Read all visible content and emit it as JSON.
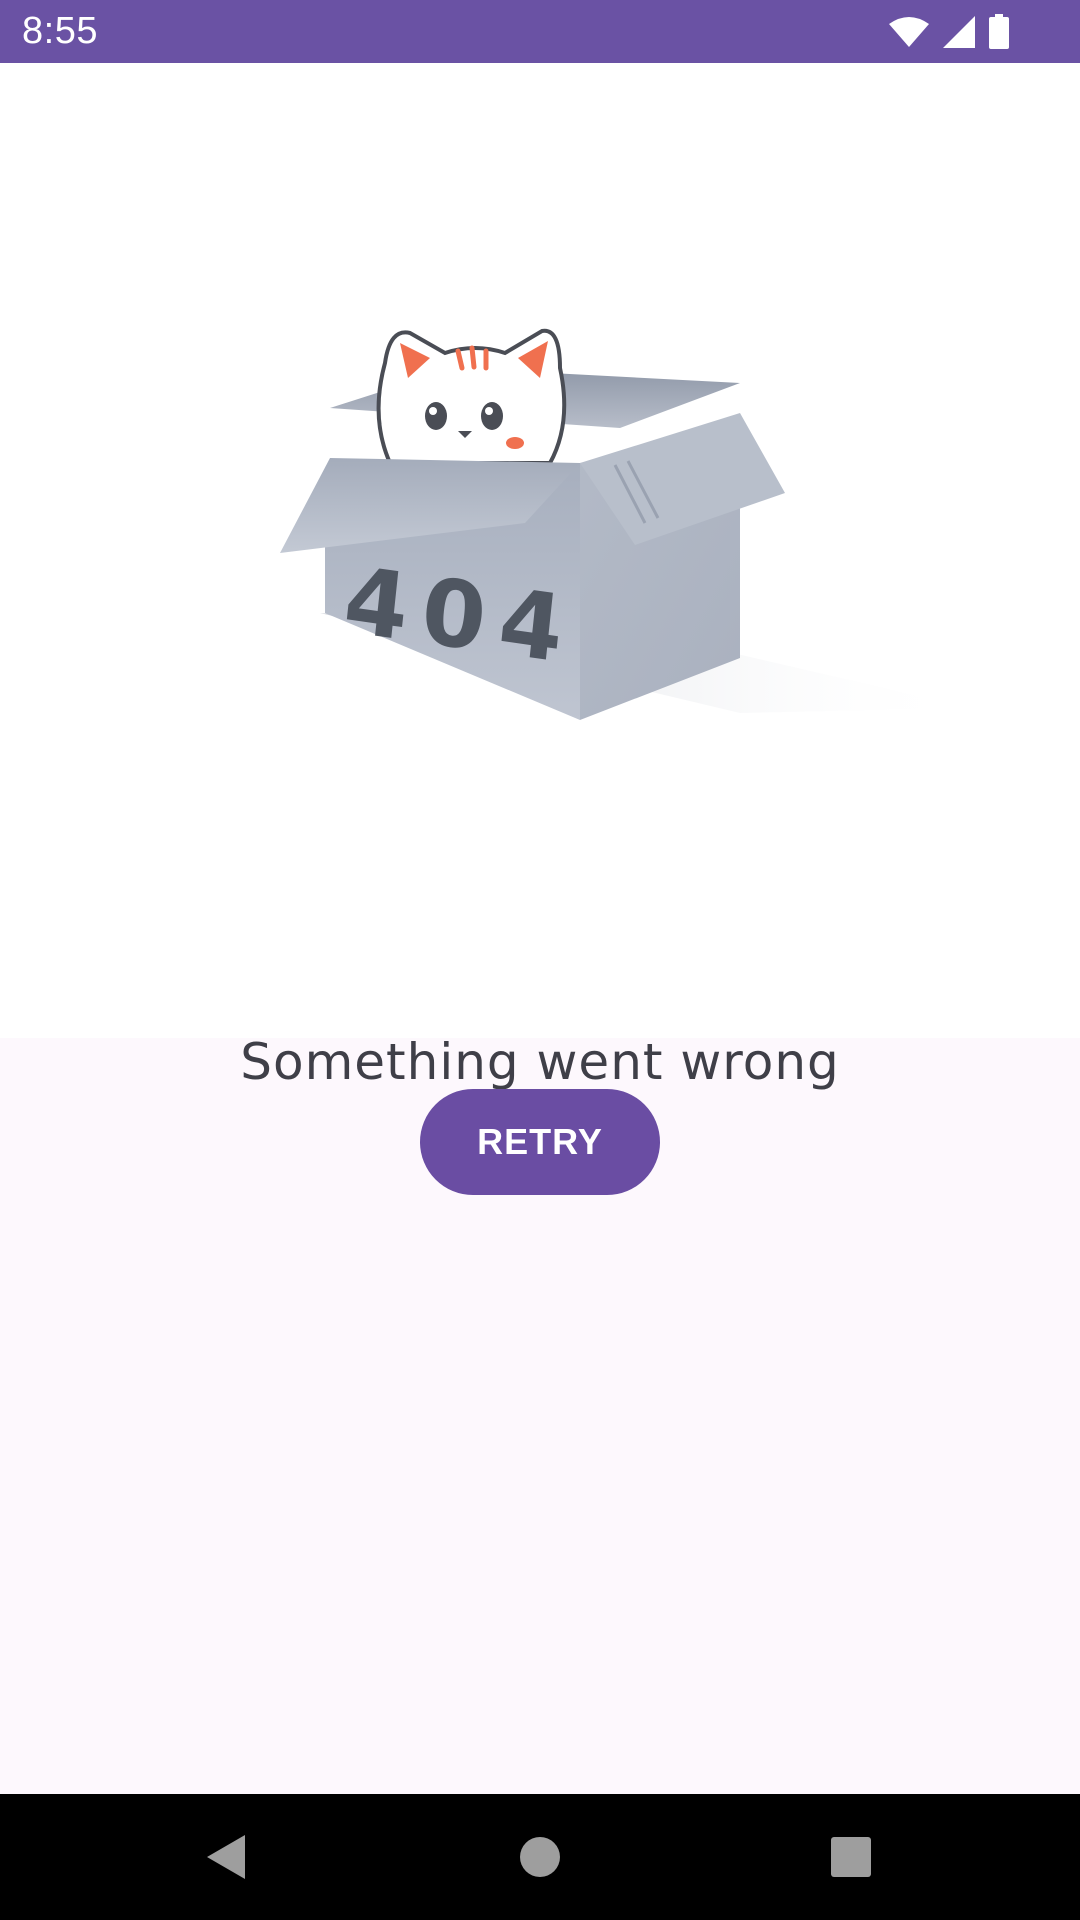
{
  "status_bar": {
    "time": "8:55",
    "background_color": "#6a52a4",
    "icons": [
      "wifi-icon",
      "cellular-signal-icon",
      "battery-icon"
    ]
  },
  "illustration": {
    "box_label": "404",
    "icon": "cat-in-box-illustration"
  },
  "error": {
    "message": "Something went wrong"
  },
  "actions": {
    "retry_label": "RETRY",
    "button_color": "#6a4da3"
  },
  "navigation_bar": {
    "buttons": [
      "back-icon",
      "home-icon",
      "recents-icon"
    ]
  }
}
